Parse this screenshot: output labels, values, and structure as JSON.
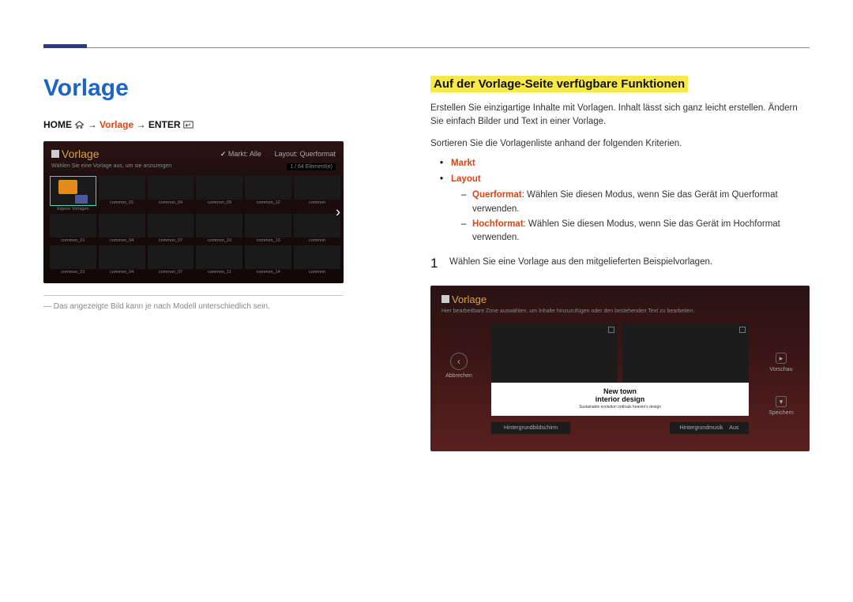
{
  "page": {
    "title": "Vorlage"
  },
  "breadcrumb": {
    "home": "HOME",
    "arrow": "→",
    "mid": "Vorlage",
    "enter": "ENTER"
  },
  "screenshot_left": {
    "title": "Vorlage",
    "subtitle": "Wählen Sie eine Vorlage aus, um sie anzuzeigen",
    "filter_market_label": "Markt",
    "filter_market_value": ": Alle",
    "filter_layout_label": "Layout",
    "filter_layout_value": ": Querformat",
    "counter": "1 / 64 Element(e)",
    "grid": [
      [
        "Eigene Vorlagen",
        "common_01",
        "common_04",
        "common_09",
        "common_12",
        "common"
      ],
      [
        "common_01",
        "common_04",
        "common_07",
        "common_10",
        "common_13",
        "common"
      ],
      [
        "common_01",
        "common_04",
        "common_07",
        "common_11",
        "common_14",
        "common"
      ]
    ]
  },
  "footnote": "Das angezeigte Bild kann je nach Modell unterschiedlich sein.",
  "section": {
    "heading": "Auf der Vorlage-Seite verfügbare Funktionen",
    "para1": "Erstellen Sie einzigartige Inhalte mit Vorlagen. Inhalt lässt sich ganz leicht erstellen. Ändern Sie einfach Bilder und Text in einer Vorlage.",
    "para2": "Sortieren Sie die Vorlagenliste anhand der folgenden Kriterien.",
    "bullets": {
      "b1": "Markt",
      "b2": "Layout",
      "querformat_label": "Querformat",
      "querformat_text": ": Wählen Sie diesen Modus, wenn Sie das Gerät im Querformat verwenden.",
      "hochformat_label": "Hochformat",
      "hochformat_text": ": Wählen Sie diesen Modus, wenn Sie das Gerät im Hochformat verwenden."
    },
    "step1_num": "1",
    "step1_text": "Wählen Sie eine Vorlage aus den mitgelieferten Beispielvorlagen."
  },
  "screenshot_right": {
    "title": "Vorlage",
    "subtitle": "Hier bearbeitbare Zone auswählen, um Inhalte hinzuzufügen oder den bestehenden Text zu bearbeiten.",
    "cancel": "Abbrechen",
    "preview_label": "Vorschau",
    "save_label": "Speichern",
    "caption_line1": "New town",
    "caption_line2": "interior design",
    "caption_line3": "Sustainable evolution ordinals heaven's design",
    "hb_label": "Hintergrundbildschirm",
    "hm_label": "Hintergrundmusik",
    "hm_value": "Aus"
  }
}
